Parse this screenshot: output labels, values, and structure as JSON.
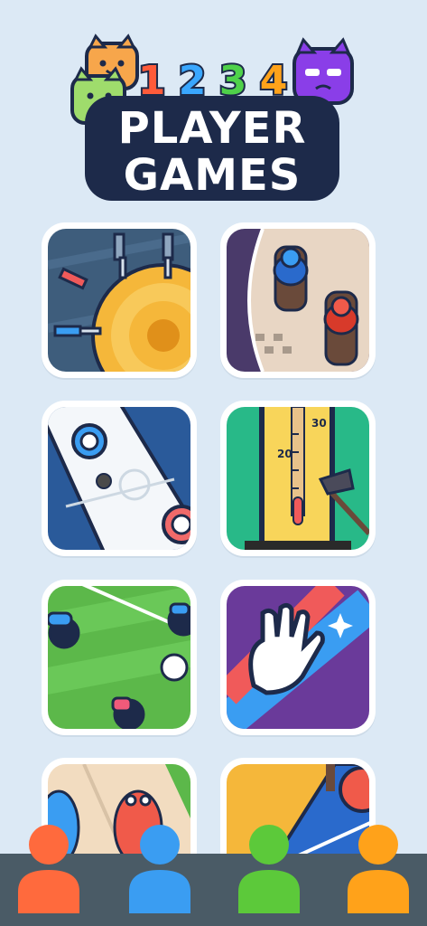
{
  "logo": {
    "numbers": [
      "1",
      "2",
      "3",
      "4"
    ],
    "number_colors": [
      "#ff5b3a",
      "#3aa7ff",
      "#4fd14a",
      "#ffa21a"
    ],
    "line1": "PLAYER",
    "line2": "GAMES"
  },
  "thermometer": {
    "labels": [
      "30",
      "20"
    ]
  },
  "games": [
    {
      "icon": "knife-throw-icon"
    },
    {
      "icon": "horse-race-icon"
    },
    {
      "icon": "air-hockey-icon"
    },
    {
      "icon": "strength-tester-icon"
    },
    {
      "icon": "soccer-icon"
    },
    {
      "icon": "slap-hands-icon"
    },
    {
      "icon": "dino-race-icon"
    },
    {
      "icon": "table-tennis-icon"
    }
  ],
  "players": [
    {
      "name": "player-1",
      "color": "#ff6a3d"
    },
    {
      "name": "player-2",
      "color": "#3a9df2"
    },
    {
      "name": "player-3",
      "color": "#5cc93a"
    },
    {
      "name": "player-4",
      "color": "#ffa21a"
    }
  ]
}
